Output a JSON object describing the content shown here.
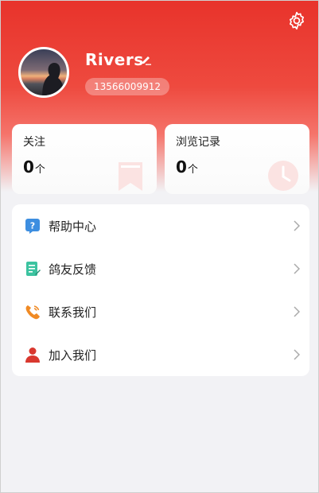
{
  "profile": {
    "username": "Rivers",
    "phone": "13566009912"
  },
  "stats": {
    "follow": {
      "label": "关注",
      "value": "0",
      "unit": "个"
    },
    "history": {
      "label": "浏览记录",
      "value": "0",
      "unit": "个"
    }
  },
  "menu": {
    "items": [
      {
        "label": "帮助中心",
        "icon": "help-icon"
      },
      {
        "label": "鸽友反馈",
        "icon": "feedback-icon"
      },
      {
        "label": "联系我们",
        "icon": "phone-icon"
      },
      {
        "label": "加入我们",
        "icon": "user-icon"
      }
    ]
  },
  "colors": {
    "brand": "#e8332b",
    "help": "#3d8ee0",
    "feedback": "#3cc3a0",
    "phone": "#f08a24",
    "user": "#d9382f"
  }
}
